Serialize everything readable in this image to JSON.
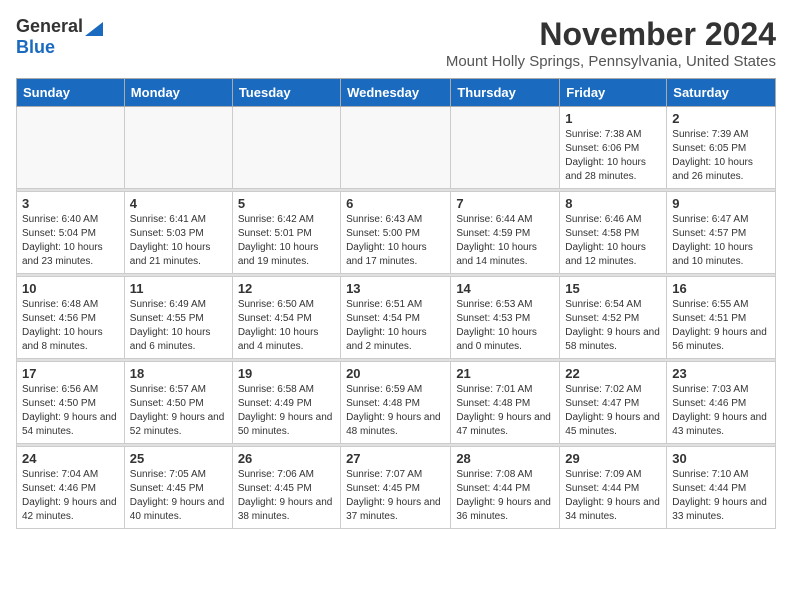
{
  "logo": {
    "general": "General",
    "blue": "Blue"
  },
  "header": {
    "title": "November 2024",
    "subtitle": "Mount Holly Springs, Pennsylvania, United States"
  },
  "weekdays": [
    "Sunday",
    "Monday",
    "Tuesday",
    "Wednesday",
    "Thursday",
    "Friday",
    "Saturday"
  ],
  "weeks": [
    [
      {
        "day": "",
        "info": ""
      },
      {
        "day": "",
        "info": ""
      },
      {
        "day": "",
        "info": ""
      },
      {
        "day": "",
        "info": ""
      },
      {
        "day": "",
        "info": ""
      },
      {
        "day": "1",
        "info": "Sunrise: 7:38 AM\nSunset: 6:06 PM\nDaylight: 10 hours and 28 minutes."
      },
      {
        "day": "2",
        "info": "Sunrise: 7:39 AM\nSunset: 6:05 PM\nDaylight: 10 hours and 26 minutes."
      }
    ],
    [
      {
        "day": "3",
        "info": "Sunrise: 6:40 AM\nSunset: 5:04 PM\nDaylight: 10 hours and 23 minutes."
      },
      {
        "day": "4",
        "info": "Sunrise: 6:41 AM\nSunset: 5:03 PM\nDaylight: 10 hours and 21 minutes."
      },
      {
        "day": "5",
        "info": "Sunrise: 6:42 AM\nSunset: 5:01 PM\nDaylight: 10 hours and 19 minutes."
      },
      {
        "day": "6",
        "info": "Sunrise: 6:43 AM\nSunset: 5:00 PM\nDaylight: 10 hours and 17 minutes."
      },
      {
        "day": "7",
        "info": "Sunrise: 6:44 AM\nSunset: 4:59 PM\nDaylight: 10 hours and 14 minutes."
      },
      {
        "day": "8",
        "info": "Sunrise: 6:46 AM\nSunset: 4:58 PM\nDaylight: 10 hours and 12 minutes."
      },
      {
        "day": "9",
        "info": "Sunrise: 6:47 AM\nSunset: 4:57 PM\nDaylight: 10 hours and 10 minutes."
      }
    ],
    [
      {
        "day": "10",
        "info": "Sunrise: 6:48 AM\nSunset: 4:56 PM\nDaylight: 10 hours and 8 minutes."
      },
      {
        "day": "11",
        "info": "Sunrise: 6:49 AM\nSunset: 4:55 PM\nDaylight: 10 hours and 6 minutes."
      },
      {
        "day": "12",
        "info": "Sunrise: 6:50 AM\nSunset: 4:54 PM\nDaylight: 10 hours and 4 minutes."
      },
      {
        "day": "13",
        "info": "Sunrise: 6:51 AM\nSunset: 4:54 PM\nDaylight: 10 hours and 2 minutes."
      },
      {
        "day": "14",
        "info": "Sunrise: 6:53 AM\nSunset: 4:53 PM\nDaylight: 10 hours and 0 minutes."
      },
      {
        "day": "15",
        "info": "Sunrise: 6:54 AM\nSunset: 4:52 PM\nDaylight: 9 hours and 58 minutes."
      },
      {
        "day": "16",
        "info": "Sunrise: 6:55 AM\nSunset: 4:51 PM\nDaylight: 9 hours and 56 minutes."
      }
    ],
    [
      {
        "day": "17",
        "info": "Sunrise: 6:56 AM\nSunset: 4:50 PM\nDaylight: 9 hours and 54 minutes."
      },
      {
        "day": "18",
        "info": "Sunrise: 6:57 AM\nSunset: 4:50 PM\nDaylight: 9 hours and 52 minutes."
      },
      {
        "day": "19",
        "info": "Sunrise: 6:58 AM\nSunset: 4:49 PM\nDaylight: 9 hours and 50 minutes."
      },
      {
        "day": "20",
        "info": "Sunrise: 6:59 AM\nSunset: 4:48 PM\nDaylight: 9 hours and 48 minutes."
      },
      {
        "day": "21",
        "info": "Sunrise: 7:01 AM\nSunset: 4:48 PM\nDaylight: 9 hours and 47 minutes."
      },
      {
        "day": "22",
        "info": "Sunrise: 7:02 AM\nSunset: 4:47 PM\nDaylight: 9 hours and 45 minutes."
      },
      {
        "day": "23",
        "info": "Sunrise: 7:03 AM\nSunset: 4:46 PM\nDaylight: 9 hours and 43 minutes."
      }
    ],
    [
      {
        "day": "24",
        "info": "Sunrise: 7:04 AM\nSunset: 4:46 PM\nDaylight: 9 hours and 42 minutes."
      },
      {
        "day": "25",
        "info": "Sunrise: 7:05 AM\nSunset: 4:45 PM\nDaylight: 9 hours and 40 minutes."
      },
      {
        "day": "26",
        "info": "Sunrise: 7:06 AM\nSunset: 4:45 PM\nDaylight: 9 hours and 38 minutes."
      },
      {
        "day": "27",
        "info": "Sunrise: 7:07 AM\nSunset: 4:45 PM\nDaylight: 9 hours and 37 minutes."
      },
      {
        "day": "28",
        "info": "Sunrise: 7:08 AM\nSunset: 4:44 PM\nDaylight: 9 hours and 36 minutes."
      },
      {
        "day": "29",
        "info": "Sunrise: 7:09 AM\nSunset: 4:44 PM\nDaylight: 9 hours and 34 minutes."
      },
      {
        "day": "30",
        "info": "Sunrise: 7:10 AM\nSunset: 4:44 PM\nDaylight: 9 hours and 33 minutes."
      }
    ]
  ]
}
